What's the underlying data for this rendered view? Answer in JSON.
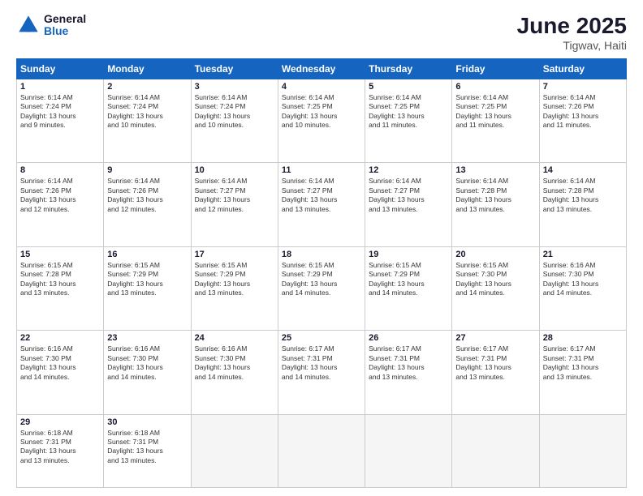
{
  "logo": {
    "line1": "General",
    "line2": "Blue"
  },
  "title": "June 2025",
  "subtitle": "Tigwav, Haiti",
  "weekdays": [
    "Sunday",
    "Monday",
    "Tuesday",
    "Wednesday",
    "Thursday",
    "Friday",
    "Saturday"
  ],
  "weeks": [
    [
      {
        "day": 1,
        "info": "Sunrise: 6:14 AM\nSunset: 7:24 PM\nDaylight: 13 hours\nand 9 minutes."
      },
      {
        "day": 2,
        "info": "Sunrise: 6:14 AM\nSunset: 7:24 PM\nDaylight: 13 hours\nand 10 minutes."
      },
      {
        "day": 3,
        "info": "Sunrise: 6:14 AM\nSunset: 7:24 PM\nDaylight: 13 hours\nand 10 minutes."
      },
      {
        "day": 4,
        "info": "Sunrise: 6:14 AM\nSunset: 7:25 PM\nDaylight: 13 hours\nand 10 minutes."
      },
      {
        "day": 5,
        "info": "Sunrise: 6:14 AM\nSunset: 7:25 PM\nDaylight: 13 hours\nand 11 minutes."
      },
      {
        "day": 6,
        "info": "Sunrise: 6:14 AM\nSunset: 7:25 PM\nDaylight: 13 hours\nand 11 minutes."
      },
      {
        "day": 7,
        "info": "Sunrise: 6:14 AM\nSunset: 7:26 PM\nDaylight: 13 hours\nand 11 minutes."
      }
    ],
    [
      {
        "day": 8,
        "info": "Sunrise: 6:14 AM\nSunset: 7:26 PM\nDaylight: 13 hours\nand 12 minutes."
      },
      {
        "day": 9,
        "info": "Sunrise: 6:14 AM\nSunset: 7:26 PM\nDaylight: 13 hours\nand 12 minutes."
      },
      {
        "day": 10,
        "info": "Sunrise: 6:14 AM\nSunset: 7:27 PM\nDaylight: 13 hours\nand 12 minutes."
      },
      {
        "day": 11,
        "info": "Sunrise: 6:14 AM\nSunset: 7:27 PM\nDaylight: 13 hours\nand 13 minutes."
      },
      {
        "day": 12,
        "info": "Sunrise: 6:14 AM\nSunset: 7:27 PM\nDaylight: 13 hours\nand 13 minutes."
      },
      {
        "day": 13,
        "info": "Sunrise: 6:14 AM\nSunset: 7:28 PM\nDaylight: 13 hours\nand 13 minutes."
      },
      {
        "day": 14,
        "info": "Sunrise: 6:14 AM\nSunset: 7:28 PM\nDaylight: 13 hours\nand 13 minutes."
      }
    ],
    [
      {
        "day": 15,
        "info": "Sunrise: 6:15 AM\nSunset: 7:28 PM\nDaylight: 13 hours\nand 13 minutes."
      },
      {
        "day": 16,
        "info": "Sunrise: 6:15 AM\nSunset: 7:29 PM\nDaylight: 13 hours\nand 13 minutes."
      },
      {
        "day": 17,
        "info": "Sunrise: 6:15 AM\nSunset: 7:29 PM\nDaylight: 13 hours\nand 13 minutes."
      },
      {
        "day": 18,
        "info": "Sunrise: 6:15 AM\nSunset: 7:29 PM\nDaylight: 13 hours\nand 14 minutes."
      },
      {
        "day": 19,
        "info": "Sunrise: 6:15 AM\nSunset: 7:29 PM\nDaylight: 13 hours\nand 14 minutes."
      },
      {
        "day": 20,
        "info": "Sunrise: 6:15 AM\nSunset: 7:30 PM\nDaylight: 13 hours\nand 14 minutes."
      },
      {
        "day": 21,
        "info": "Sunrise: 6:16 AM\nSunset: 7:30 PM\nDaylight: 13 hours\nand 14 minutes."
      }
    ],
    [
      {
        "day": 22,
        "info": "Sunrise: 6:16 AM\nSunset: 7:30 PM\nDaylight: 13 hours\nand 14 minutes."
      },
      {
        "day": 23,
        "info": "Sunrise: 6:16 AM\nSunset: 7:30 PM\nDaylight: 13 hours\nand 14 minutes."
      },
      {
        "day": 24,
        "info": "Sunrise: 6:16 AM\nSunset: 7:30 PM\nDaylight: 13 hours\nand 14 minutes."
      },
      {
        "day": 25,
        "info": "Sunrise: 6:17 AM\nSunset: 7:31 PM\nDaylight: 13 hours\nand 14 minutes."
      },
      {
        "day": 26,
        "info": "Sunrise: 6:17 AM\nSunset: 7:31 PM\nDaylight: 13 hours\nand 13 minutes."
      },
      {
        "day": 27,
        "info": "Sunrise: 6:17 AM\nSunset: 7:31 PM\nDaylight: 13 hours\nand 13 minutes."
      },
      {
        "day": 28,
        "info": "Sunrise: 6:17 AM\nSunset: 7:31 PM\nDaylight: 13 hours\nand 13 minutes."
      }
    ],
    [
      {
        "day": 29,
        "info": "Sunrise: 6:18 AM\nSunset: 7:31 PM\nDaylight: 13 hours\nand 13 minutes."
      },
      {
        "day": 30,
        "info": "Sunrise: 6:18 AM\nSunset: 7:31 PM\nDaylight: 13 hours\nand 13 minutes."
      },
      null,
      null,
      null,
      null,
      null
    ]
  ]
}
